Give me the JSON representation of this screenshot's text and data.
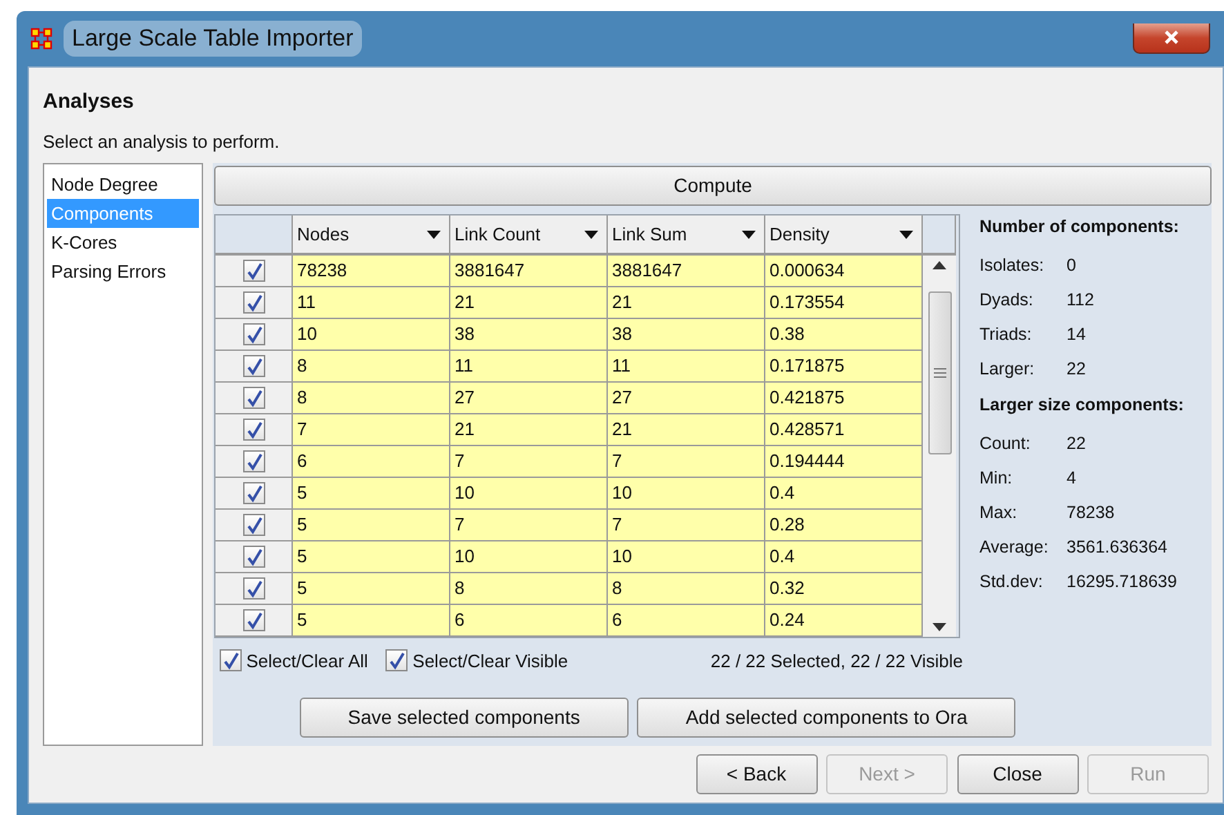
{
  "window": {
    "title": "Large Scale Table Importer"
  },
  "heading": "Analyses",
  "subtitle": "Select an analysis to perform.",
  "analyses": [
    {
      "label": "Node Degree",
      "selected": false
    },
    {
      "label": "Components",
      "selected": true
    },
    {
      "label": "K-Cores",
      "selected": false
    },
    {
      "label": "Parsing Errors",
      "selected": false
    }
  ],
  "compute_button": "Compute",
  "table": {
    "columns": [
      "Nodes",
      "Link Count",
      "Link Sum",
      "Density"
    ],
    "rows": [
      {
        "checked": true,
        "cells": [
          "78238",
          "3881647",
          "3881647",
          "0.000634"
        ]
      },
      {
        "checked": true,
        "cells": [
          "11",
          "21",
          "21",
          "0.173554"
        ]
      },
      {
        "checked": true,
        "cells": [
          "10",
          "38",
          "38",
          "0.38"
        ]
      },
      {
        "checked": true,
        "cells": [
          "8",
          "11",
          "11",
          "0.171875"
        ]
      },
      {
        "checked": true,
        "cells": [
          "8",
          "27",
          "27",
          "0.421875"
        ]
      },
      {
        "checked": true,
        "cells": [
          "7",
          "21",
          "21",
          "0.428571"
        ]
      },
      {
        "checked": true,
        "cells": [
          "6",
          "7",
          "7",
          "0.194444"
        ]
      },
      {
        "checked": true,
        "cells": [
          "5",
          "10",
          "10",
          "0.4"
        ]
      },
      {
        "checked": true,
        "cells": [
          "5",
          "7",
          "7",
          "0.28"
        ]
      },
      {
        "checked": true,
        "cells": [
          "5",
          "10",
          "10",
          "0.4"
        ]
      },
      {
        "checked": true,
        "cells": [
          "5",
          "8",
          "8",
          "0.32"
        ]
      },
      {
        "checked": true,
        "cells": [
          "5",
          "6",
          "6",
          "0.24"
        ]
      }
    ]
  },
  "select_all": {
    "label": "Select/Clear All",
    "checked": true
  },
  "select_visible": {
    "label": "Select/Clear Visible",
    "checked": true
  },
  "selection_status": "22 / 22 Selected, 22 / 22 Visible",
  "stats": [
    {
      "heading": "Number of components:",
      "items": [
        {
          "label": "Isolates:",
          "value": "0"
        },
        {
          "label": "Dyads:",
          "value": "112"
        },
        {
          "label": "Triads:",
          "value": "14"
        },
        {
          "label": "Larger:",
          "value": "22"
        }
      ]
    },
    {
      "heading": "Larger size components:",
      "items": [
        {
          "label": "Count:",
          "value": "22"
        },
        {
          "label": "Min:",
          "value": "4"
        },
        {
          "label": "Max:",
          "value": "78238"
        },
        {
          "label": "Average:",
          "value": "3561.636364"
        },
        {
          "label": "Std.dev:",
          "value": "16295.718639"
        }
      ]
    }
  ],
  "action_buttons": [
    "Save selected components",
    "Add selected components to Ora"
  ],
  "nav_buttons": [
    {
      "label": "< Back",
      "disabled": false
    },
    {
      "label": "Next >",
      "disabled": true
    },
    {
      "label": "Close",
      "disabled": false
    },
    {
      "label": "Run",
      "disabled": true
    }
  ]
}
